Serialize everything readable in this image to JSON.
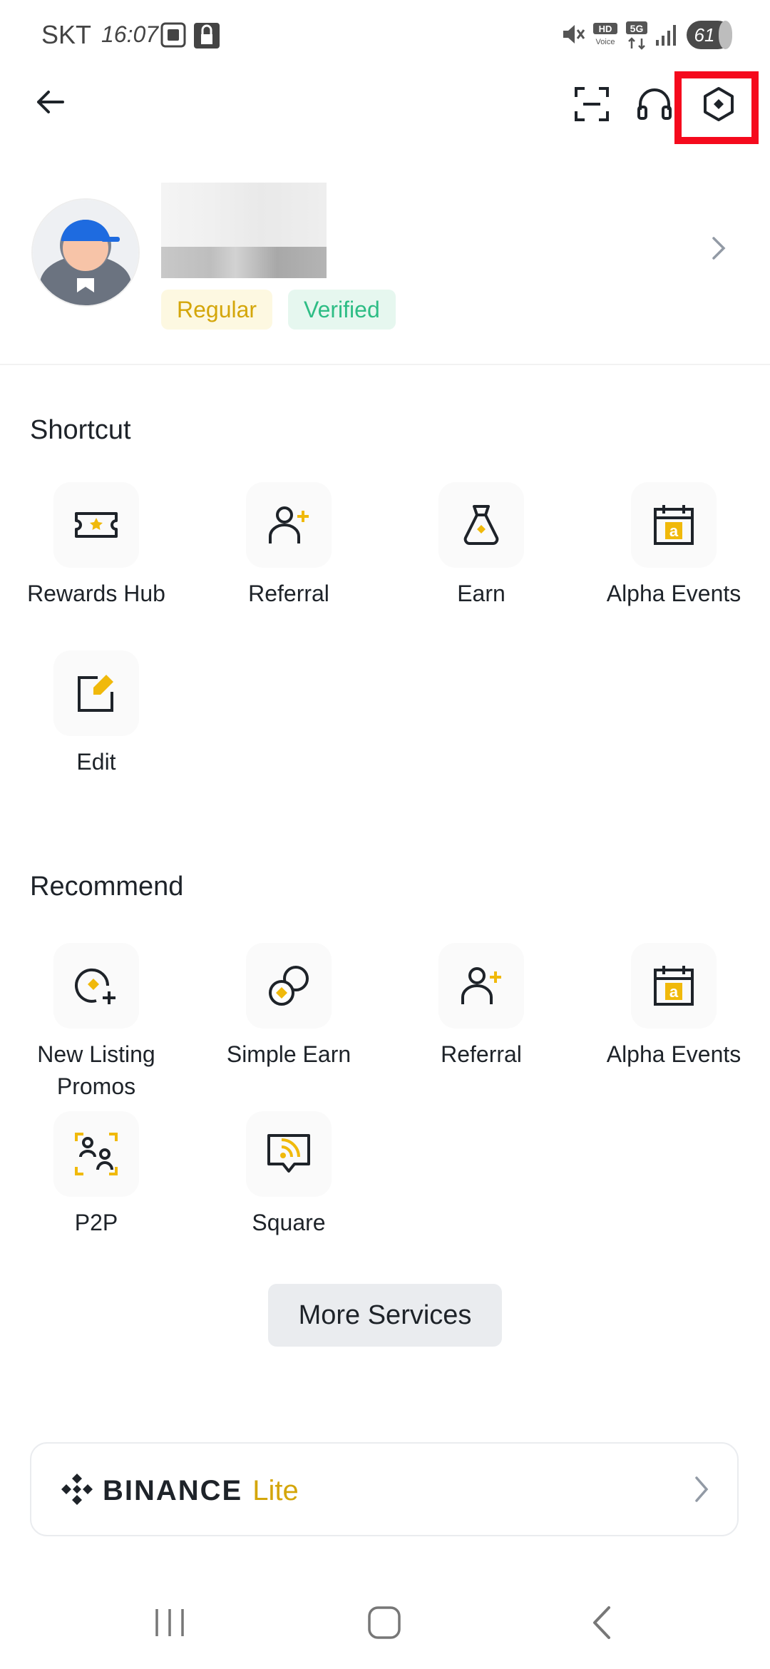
{
  "status_bar": {
    "carrier": "SKT",
    "time": "16:07",
    "battery": "61"
  },
  "topbar": {
    "back_icon": "back-arrow-icon",
    "scan_icon": "scan-icon",
    "support_icon": "headset-icon",
    "settings_icon": "settings-hexagon-icon"
  },
  "profile": {
    "badges": [
      "Regular",
      "Verified"
    ]
  },
  "shortcut": {
    "title": "Shortcut",
    "items": [
      {
        "label": "Rewards Hub",
        "icon": "ticket-star-icon"
      },
      {
        "label": "Referral",
        "icon": "person-add-icon"
      },
      {
        "label": "Earn",
        "icon": "money-bag-icon"
      },
      {
        "label": "Alpha Events",
        "icon": "calendar-alpha-icon"
      },
      {
        "label": "Edit",
        "icon": "edit-icon"
      }
    ]
  },
  "recommend": {
    "title": "Recommend",
    "items": [
      {
        "label": "New Listing Promos",
        "icon": "new-listing-icon"
      },
      {
        "label": "Simple Earn",
        "icon": "coins-icon"
      },
      {
        "label": "Referral",
        "icon": "person-add-icon"
      },
      {
        "label": "Alpha Events",
        "icon": "calendar-alpha-icon"
      },
      {
        "label": "P2P",
        "icon": "p2p-icon"
      },
      {
        "label": "Square",
        "icon": "square-feed-icon"
      }
    ]
  },
  "more_services": "More Services",
  "lite_banner": {
    "brand": "BINANCE",
    "product": "Lite"
  },
  "colors": {
    "accent": "#F0B90B",
    "highlight": "#F50A1D",
    "verified": "#2EBD85"
  }
}
